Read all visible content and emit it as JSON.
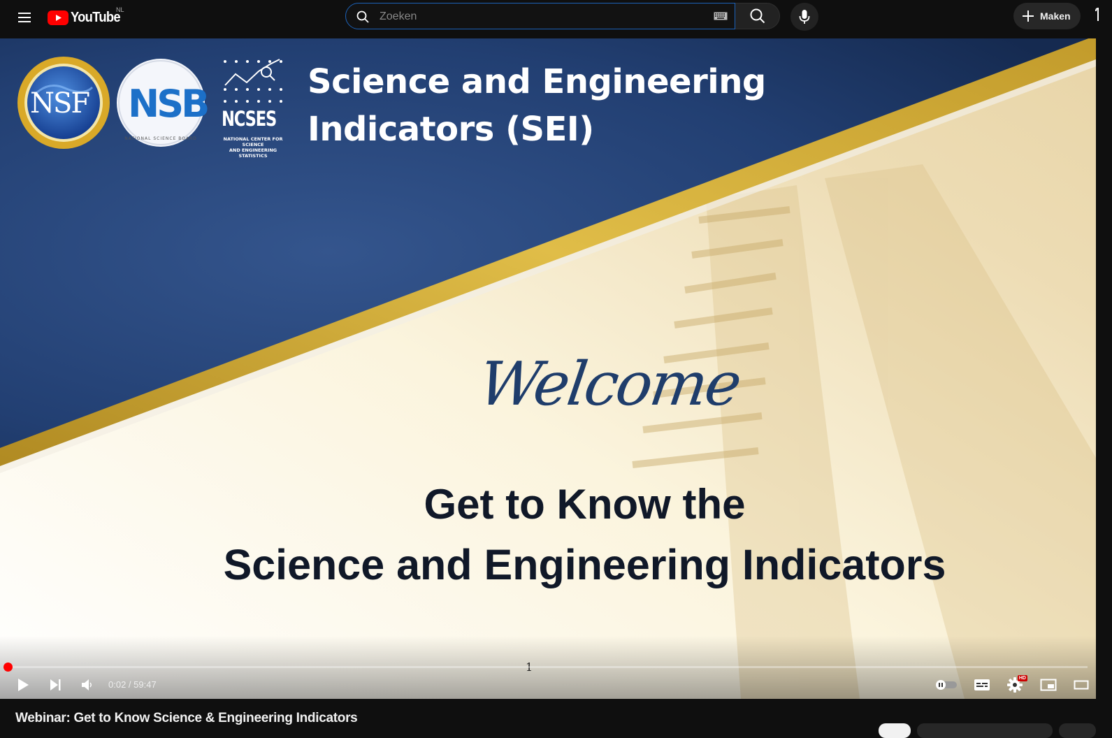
{
  "header": {
    "logo_text": "YouTube",
    "logo_country": "NL",
    "search_placeholder": "Zoeken",
    "create_label": "Maken"
  },
  "slide": {
    "title_line1": "Science and Engineering",
    "title_line2": "Indicators (SEI)",
    "logos": {
      "nsf": "NSF",
      "nsb": "NSB",
      "nsb_ring": "NATIONAL SCIENCE BOARD",
      "ncses": "NCSES",
      "ncses_sub1": "NATIONAL CENTER FOR SCIENCE",
      "ncses_sub2": "AND ENGINEERING STATISTICS"
    },
    "welcome": "Welcome",
    "headline_line1": "Get to Know the",
    "headline_line2": "Science and Engineering Indicators",
    "slide_number": "1"
  },
  "player": {
    "current_time": "0:02",
    "duration": "59:47",
    "time_display": "0:02 / 59:47",
    "progress_fraction": 0.0006,
    "hd_badge": "HD"
  },
  "video": {
    "title": "Webinar: Get to Know Science & Engineering Indicators"
  },
  "colors": {
    "accent_red": "#ff0000",
    "slide_navy": "#1b3260",
    "slide_gold": "#c9a227",
    "welcome_blue": "#1f3d6b"
  }
}
